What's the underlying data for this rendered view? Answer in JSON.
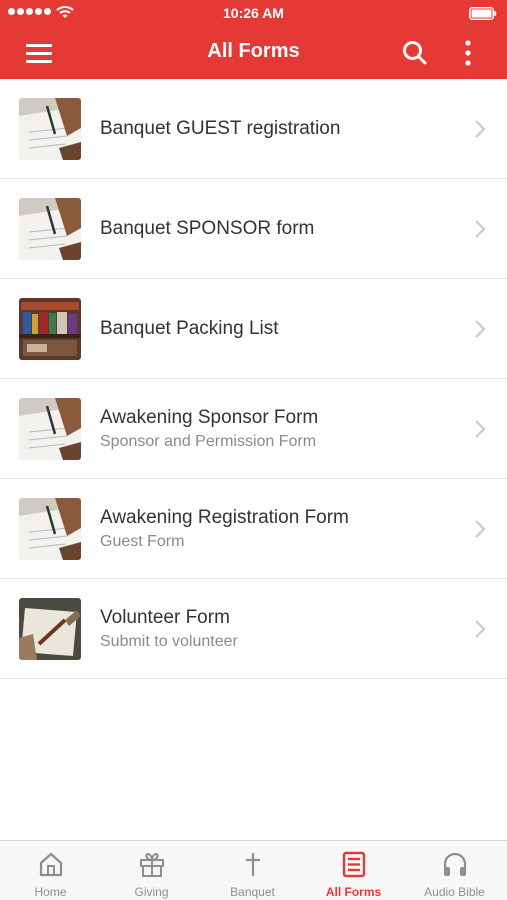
{
  "status_bar": {
    "time": "10:26 AM"
  },
  "app_bar": {
    "title": "All Forms"
  },
  "forms": [
    {
      "title": "Banquet GUEST registration",
      "subtitle": "",
      "thumbnail": "writing-hand-image"
    },
    {
      "title": "Banquet SPONSOR form",
      "subtitle": "",
      "thumbnail": "writing-hand-image"
    },
    {
      "title": "Banquet Packing List",
      "subtitle": "",
      "thumbnail": "books-shelf-image"
    },
    {
      "title": "Awakening Sponsor Form",
      "subtitle": "Sponsor and Permission Form",
      "thumbnail": "writing-hand-image"
    },
    {
      "title": "Awakening Registration Form",
      "subtitle": "Guest Form",
      "thumbnail": "writing-hand-image"
    },
    {
      "title": "Volunteer Form",
      "subtitle": "Submit to volunteer",
      "thumbnail": "pen-paper-image"
    }
  ],
  "tab_bar": {
    "tabs": [
      {
        "label": "Home",
        "icon": "home-icon"
      },
      {
        "label": "Giving",
        "icon": "gift-icon"
      },
      {
        "label": "Banquet",
        "icon": "cross-icon"
      },
      {
        "label": "All Forms",
        "icon": "forms-icon"
      },
      {
        "label": "Audio Bible",
        "icon": "headphones-icon"
      }
    ],
    "active_tab": "All Forms"
  },
  "colors": {
    "brand": "#e53935",
    "tab_inactive": "#8e8e8e"
  }
}
